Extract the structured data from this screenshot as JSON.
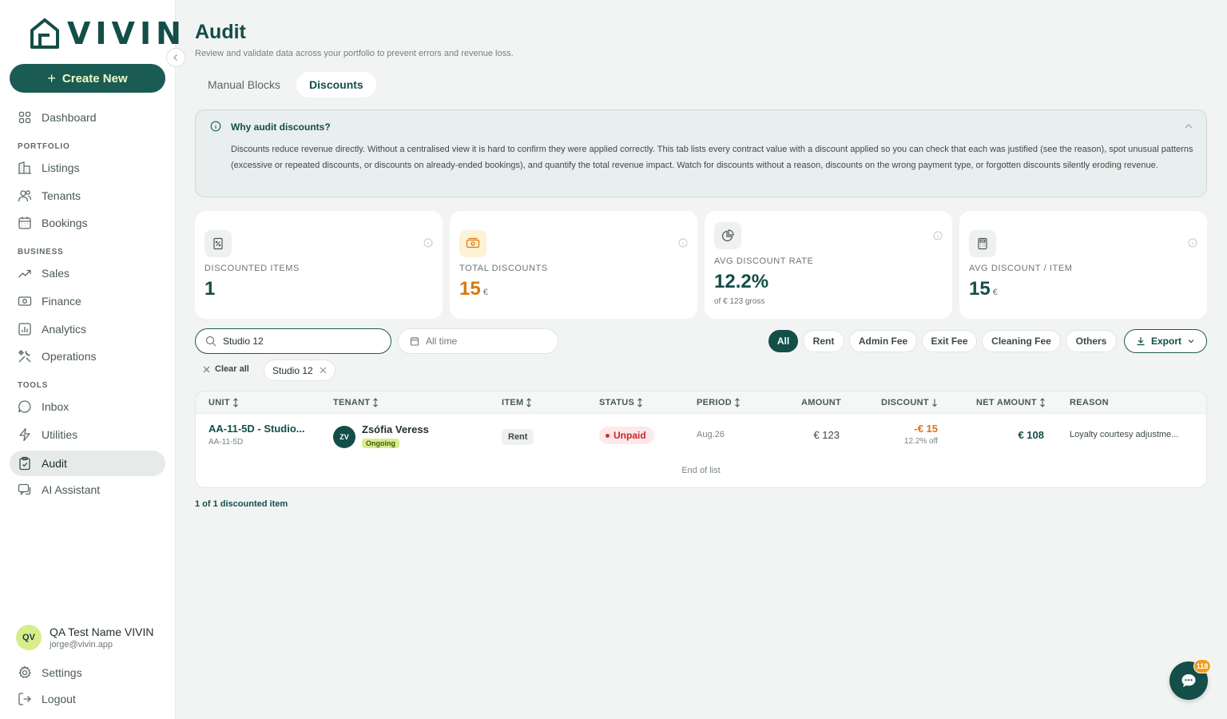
{
  "brand": {
    "name": "VIVIN",
    "accent": "#134e48",
    "highlight": "#d9ec8c"
  },
  "sidebar": {
    "create_label": "Create New",
    "items": {
      "dashboard": "Dashboard",
      "listings": "Listings",
      "tenants": "Tenants",
      "bookings": "Bookings",
      "sales": "Sales",
      "finance": "Finance",
      "analytics": "Analytics",
      "operations": "Operations",
      "inbox": "Inbox",
      "utilities": "Utilities",
      "audit": "Audit",
      "ai_assistant": "AI Assistant",
      "settings": "Settings",
      "logout": "Logout"
    },
    "sections": {
      "portfolio": "PORTFOLIO",
      "business": "BUSINESS",
      "tools": "TOOLS"
    },
    "user": {
      "initials": "QV",
      "name": "QA Test Name VIVIN",
      "email": "jorge@vivin.app"
    }
  },
  "page": {
    "title": "Audit",
    "subtitle": "Review and validate data across your portfolio to prevent errors and revenue loss.",
    "tabs": {
      "manual_blocks": "Manual Blocks",
      "discounts": "Discounts"
    }
  },
  "info": {
    "title": "Why audit discounts?",
    "text": "Discounts reduce revenue directly. Without a centralised view it is hard to confirm they were applied correctly. This tab lists every contract value with a discount applied so you can check that each was justified (see the reason), spot unusual patterns (excessive or repeated discounts, or discounts on already-ended bookings), and quantify the total revenue impact. Watch for discounts without a reason, discounts on the wrong payment type, or forgotten discounts silently eroding revenue."
  },
  "stats": {
    "discounted_items": {
      "label": "DISCOUNTED ITEMS",
      "value": "1"
    },
    "total_discounts": {
      "label": "TOTAL DISCOUNTS",
      "value": "15",
      "unit": "€"
    },
    "avg_rate": {
      "label": "AVG DISCOUNT RATE",
      "value": "12.2%",
      "foot": "of € 123 gross"
    },
    "avg_item": {
      "label": "AVG DISCOUNT / ITEM",
      "value": "15",
      "unit": "€"
    }
  },
  "filters": {
    "search_value": "Studio 12",
    "date_label": "All time",
    "chips": {
      "all": "All",
      "rent": "Rent",
      "admin_fee": "Admin Fee",
      "exit_fee": "Exit Fee",
      "cleaning_fee": "Cleaning Fee",
      "others": "Others"
    },
    "export_label": "Export",
    "clear_all": "Clear all",
    "active_tag": "Studio 12"
  },
  "table": {
    "headers": {
      "unit": "UNIT",
      "tenant": "TENANT",
      "item": "ITEM",
      "status": "STATUS",
      "period": "PERIOD",
      "amount": "AMOUNT",
      "discount": "DISCOUNT",
      "net": "NET AMOUNT",
      "reason": "REASON"
    },
    "rows": [
      {
        "unit": "AA-11-5D - Studio...",
        "unit_code": "AA-11-5D",
        "tenant_initials": "ZV",
        "tenant": "Zsófia Veress",
        "tenant_status": "Ongoing",
        "item": "Rent",
        "status": "Unpaid",
        "period": "Aug.26",
        "amount": "€ 123",
        "discount": "-€ 15",
        "discount_pct": "12.2% off",
        "net": "€ 108",
        "reason": "Loyalty courtesy adjustme..."
      }
    ],
    "end_label": "End of list"
  },
  "footer_count": "1 of 1 discounted item",
  "chat": {
    "badge": "118"
  }
}
